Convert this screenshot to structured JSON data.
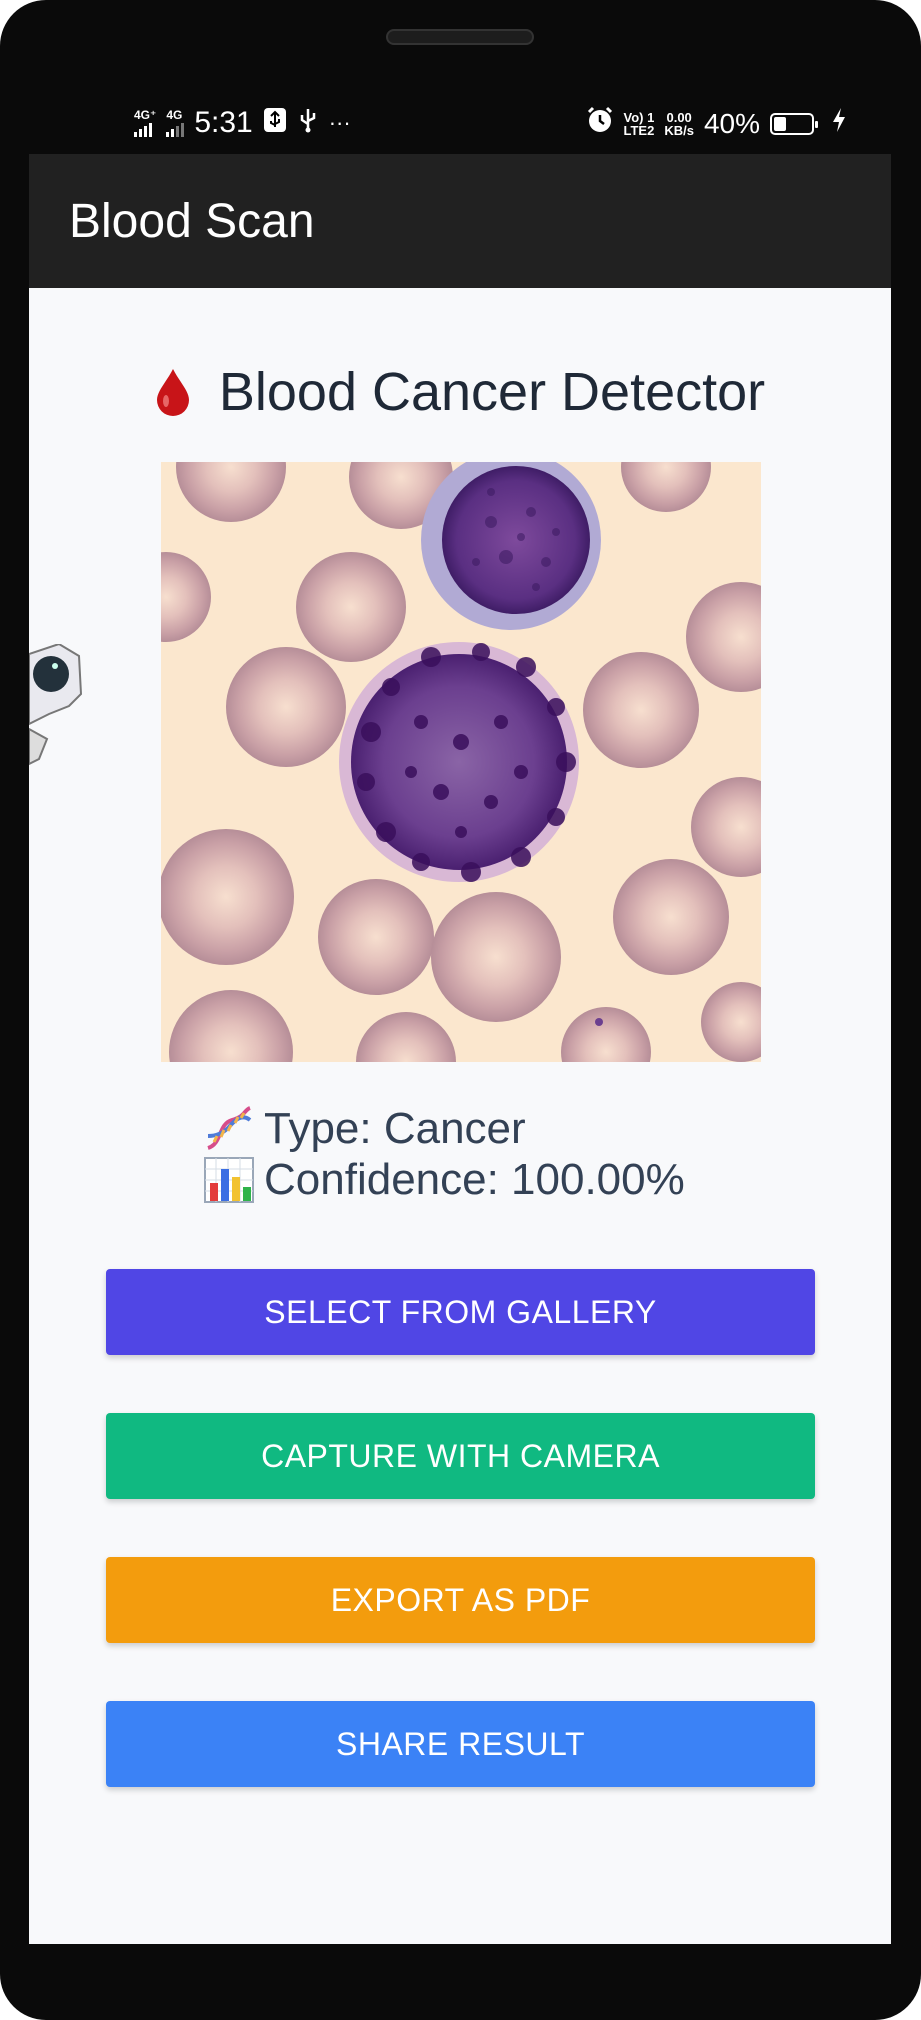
{
  "status_bar": {
    "network_1": "4G⁺",
    "network_2": "4G",
    "time": "5:31",
    "more_indicator": "···",
    "volte": "Vo) 1",
    "lte": "LTE2",
    "speed_value": "0.00",
    "speed_unit": "KB/s",
    "battery_percent": "40%",
    "battery_level": 0.4,
    "icons": [
      "usb-icon",
      "usb-trident-icon",
      "alarm-icon",
      "charging-icon"
    ]
  },
  "appbar": {
    "title": "Blood Scan"
  },
  "header": {
    "title": "Blood Cancer Detector",
    "icon": "blood-drop-icon"
  },
  "result": {
    "type_text": "Type: Cancer",
    "confidence_text": "Confidence: 100.00%",
    "type_icon": "dna-icon",
    "confidence_icon": "bar-chart-icon"
  },
  "buttons": {
    "gallery": "SELECT FROM GALLERY",
    "camera": "CAPTURE WITH CAMERA",
    "export": "EXPORT AS PDF",
    "share": "SHARE RESULT"
  },
  "colors": {
    "appbar": "#212121",
    "gallery": "#5046e5",
    "camera": "#10b981",
    "export": "#f39c0d",
    "share": "#3b82f6",
    "title_text": "#1f2937"
  }
}
